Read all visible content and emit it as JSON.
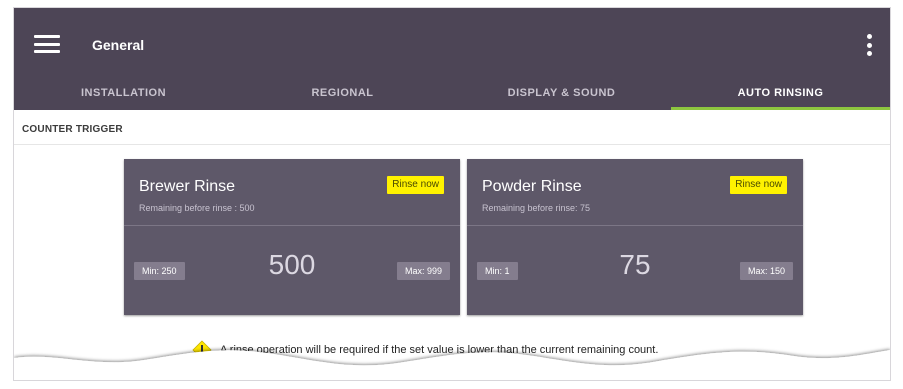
{
  "header": {
    "title": "General"
  },
  "tabs": [
    {
      "label": "INSTALLATION"
    },
    {
      "label": "REGIONAL"
    },
    {
      "label": "DISPLAY & SOUND"
    },
    {
      "label": "AUTO RINSING"
    }
  ],
  "section": {
    "label": "COUNTER TRIGGER"
  },
  "cards": [
    {
      "title": "Brewer Rinse",
      "subtitle": "Remaining before rinse : 500",
      "button": "Rinse now",
      "min": "Min: 250",
      "value": "500",
      "max": "Max: 999"
    },
    {
      "title": "Powder Rinse",
      "subtitle": "Remaining before rinse: 75",
      "button": "Rinse now",
      "min": "Min: 1",
      "value": "75",
      "max": "Max: 150"
    }
  ],
  "note": {
    "text": "A rinse operation will be required if the set value is lower than the current remaining count."
  },
  "icons": {
    "menu": "hamburger-menu-icon",
    "more": "kebab-menu-icon",
    "warning": "warning-icon"
  },
  "colors": {
    "appbar": "#4d4556",
    "active_tab_indicator": "#8dc63f",
    "card": "#5e5869",
    "rinse_button": "#fff200"
  }
}
